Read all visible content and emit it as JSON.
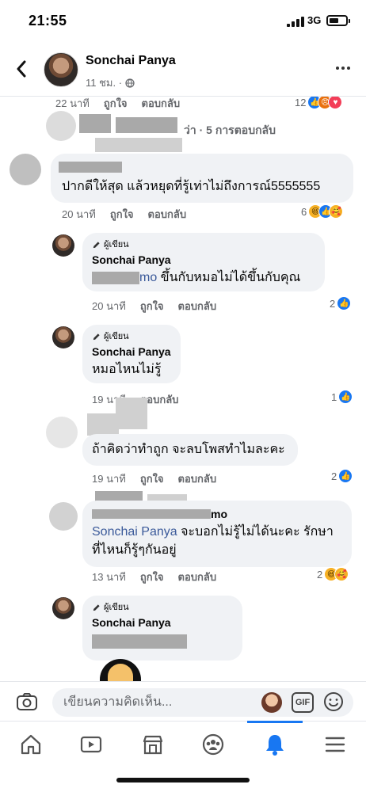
{
  "status": {
    "time": "21:55",
    "network": "3G"
  },
  "header": {
    "name": "Sonchai Panya",
    "meta": "11 ชม. ·"
  },
  "comments": {
    "top_fragment": {
      "time": "22 นาที",
      "like": "ถูกใจ",
      "reply": "ตอบกลับ",
      "count": "12"
    },
    "replies_link": "ว่า · 5 การตอบกลับ",
    "c1": {
      "text": "ปากดีให้สุด แล้วหยุดที่รู้เท่าไม่ถึงการณ์5555555",
      "time": "20 นาที",
      "like": "ถูกใจ",
      "reply": "ตอบกลับ",
      "count": "6"
    },
    "r1": {
      "badge": "ผู้เขียน",
      "name": "Sonchai Panya",
      "tag_fragment": "mo",
      "text": " ขึ้นกับหมอไม่ได้ขึ้นกับคุณ",
      "time": "20 นาที",
      "like": "ถูกใจ",
      "reply": "ตอบกลับ",
      "count": "2"
    },
    "r2": {
      "badge": "ผู้เขียน",
      "name": "Sonchai Panya",
      "text": "หมอไหนไม่รู้",
      "time": "19 นาที",
      "reply": "ตอบกลับ",
      "count": "1"
    },
    "c2": {
      "text": "ถ้าคิดว่าทำถูก จะลบโพสทำไมละคะ",
      "time": "19 นาที",
      "like": "ถูกใจ",
      "reply": "ตอบกลับ",
      "count": "2"
    },
    "c3": {
      "name_fragment": "mo",
      "mention": "Sonchai Panya",
      "text_line1": " จะบอกไม่รู้ไม่ได้นะคะ รักษา",
      "text_line2": "ที่ไหนก็รู้ๆกันอยู่",
      "time": "13 นาที",
      "like": "ถูกใจ",
      "reply": "ตอบกลับ",
      "count": "2"
    },
    "r3": {
      "badge": "ผู้เขียน",
      "name": "Sonchai Panya"
    }
  },
  "composer": {
    "placeholder": "เขียนความคิดเห็น...",
    "gif_label": "GIF"
  },
  "colors": {
    "accent": "#1877f2",
    "bubble": "#f0f2f5",
    "muted": "#65676b"
  }
}
